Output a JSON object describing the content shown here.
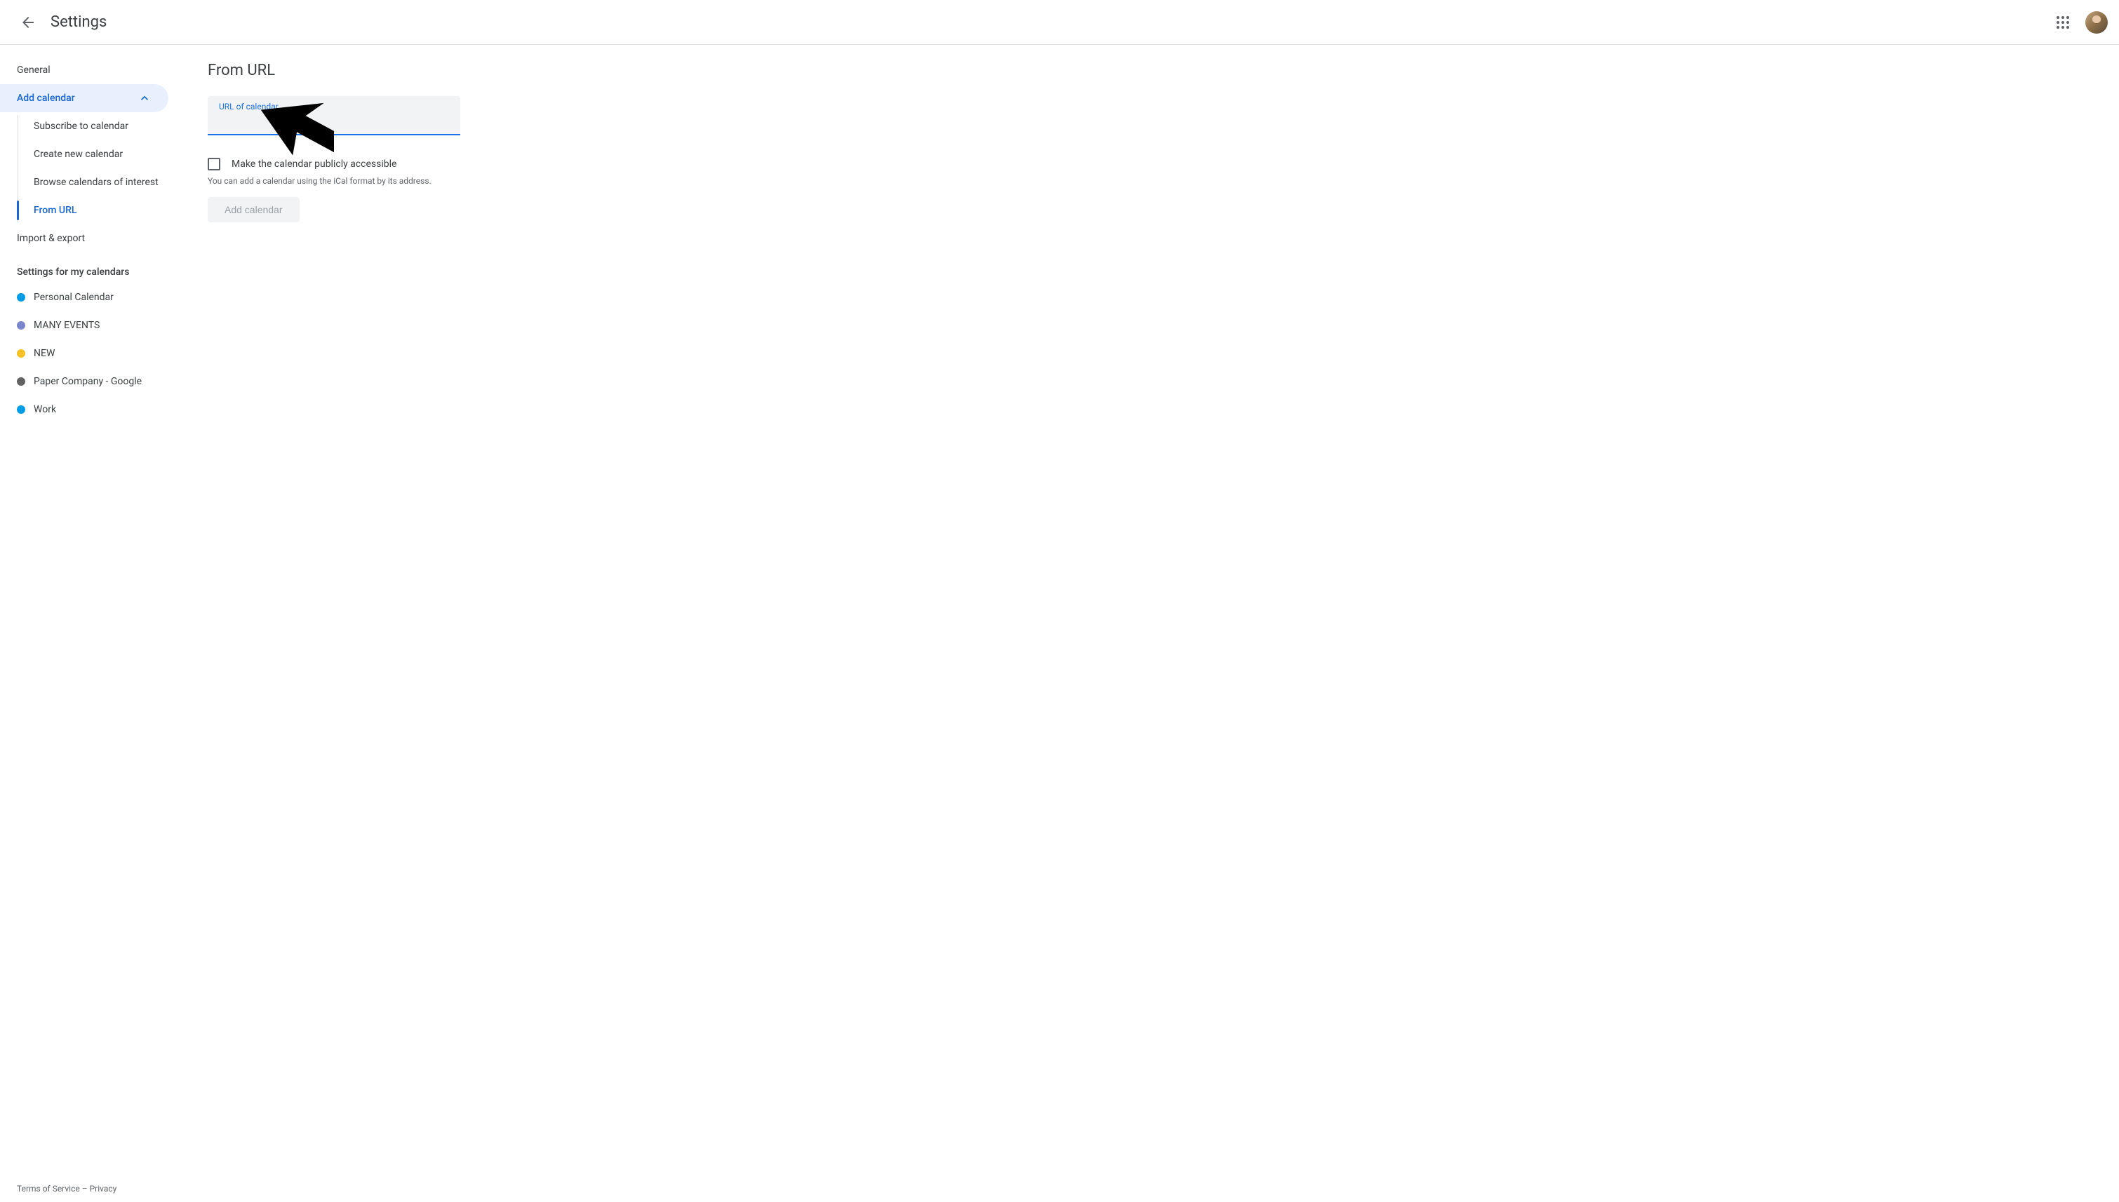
{
  "header": {
    "title": "Settings"
  },
  "sidebar": {
    "general": "General",
    "add_calendar": "Add calendar",
    "subscribe": "Subscribe to calendar",
    "create_new": "Create new calendar",
    "browse": "Browse calendars of interest",
    "from_url": "From URL",
    "import_export": "Import & export",
    "my_calendars_header": "Settings for my calendars",
    "calendars": [
      {
        "name": "Personal Calendar",
        "color": "#039be5"
      },
      {
        "name": "MANY EVENTS",
        "color": "#7986cb"
      },
      {
        "name": "NEW",
        "color": "#f6bf26"
      },
      {
        "name": "Paper Company - Google",
        "color": "#616161"
      },
      {
        "name": "Work",
        "color": "#039be5"
      }
    ]
  },
  "main": {
    "title": "From URL",
    "input_label": "URL of calendar",
    "input_value": "",
    "checkbox_label": "Make the calendar publicly accessible",
    "helper_text": "You can add a calendar using the iCal format by its address.",
    "button_label": "Add calendar"
  },
  "footer": {
    "terms": "Terms of Service",
    "separator": " – ",
    "privacy": "Privacy"
  }
}
